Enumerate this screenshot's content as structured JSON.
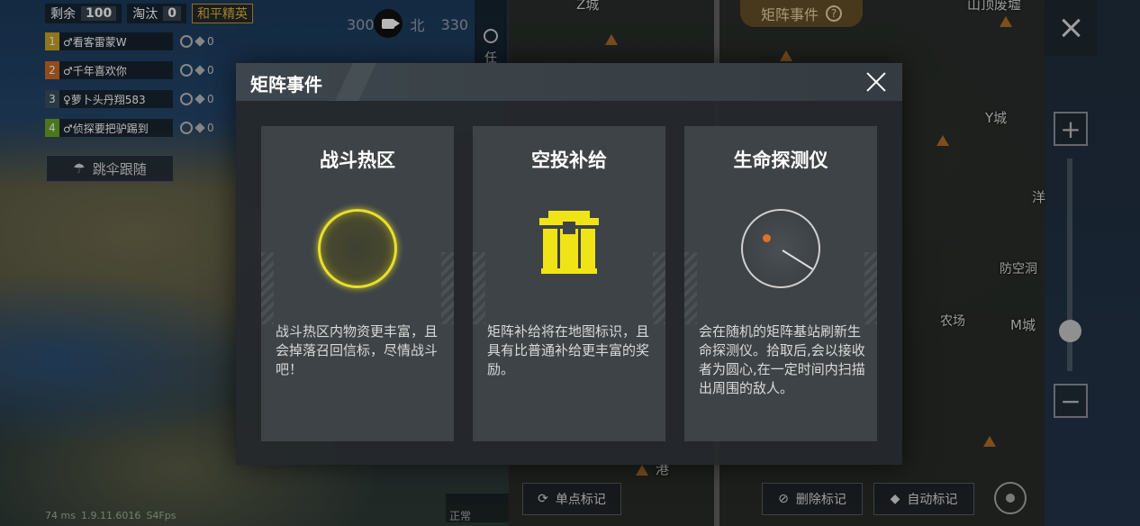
{
  "hud": {
    "remaining_label": "剩余",
    "remaining_count": "100",
    "eliminated_label": "淘汰",
    "eliminated_count": "0",
    "mode_label": "和平精英"
  },
  "team": [
    {
      "index": "1",
      "name": "♂看客雷蒙W",
      "color": "#c9a227",
      "score": "0"
    },
    {
      "index": "2",
      "name": "♂千年喜欢你",
      "color": "#c96a27",
      "score": "0"
    },
    {
      "index": "3",
      "name": "♀萝卜头丹翔583",
      "color": "#3a4e5c",
      "score": "0"
    },
    {
      "index": "4",
      "name": "♂侦探要把驴踢到",
      "color": "#6aa427",
      "score": "0"
    }
  ],
  "follow_button": "跳伞跟随",
  "compass": {
    "left": "300",
    "center": "北",
    "right": "330"
  },
  "side_tab_text": "任",
  "matrix_pill": {
    "label": "矩阵事件",
    "help": "?"
  },
  "map_labels": [
    {
      "text": "Z城"
    },
    {
      "text": "山顶废墟"
    },
    {
      "text": "Y城"
    },
    {
      "text": "洋"
    },
    {
      "text": "防空洞"
    },
    {
      "text": "农场"
    },
    {
      "text": "M城"
    },
    {
      "text": "港"
    }
  ],
  "zoom": {
    "in": "+",
    "out": "−",
    "level": 0.15
  },
  "bottom": {
    "single_mark": "单点标记",
    "delete_mark": "删除标记",
    "auto_mark": "自动标记",
    "mini_tab": "正常"
  },
  "status_bar": {
    "ping": "74 ms",
    "version": "1.9.11.6016",
    "fps": "S4Fps"
  },
  "modal": {
    "title": "矩阵事件",
    "cards": [
      {
        "title": "战斗热区",
        "icon": "hot-zone-icon",
        "desc": "战斗热区内物资更丰富，且会掉落召回信标，尽情战斗吧！"
      },
      {
        "title": "空投补给",
        "icon": "airdrop-crate-icon",
        "desc": "矩阵补给将在地图标识，且具有比普通补给更丰富的奖励。"
      },
      {
        "title": "生命探测仪",
        "icon": "life-detector-icon",
        "desc": "会在随机的矩阵基站刷新生命探测仪。拾取后,会以接收者为圆心,在一定时间内扫描出周围的敌人。"
      }
    ]
  },
  "colors": {
    "accent_yellow": "#e8e02a",
    "mode_gold": "#e2b43a",
    "radar_dot": "#e0702a"
  }
}
